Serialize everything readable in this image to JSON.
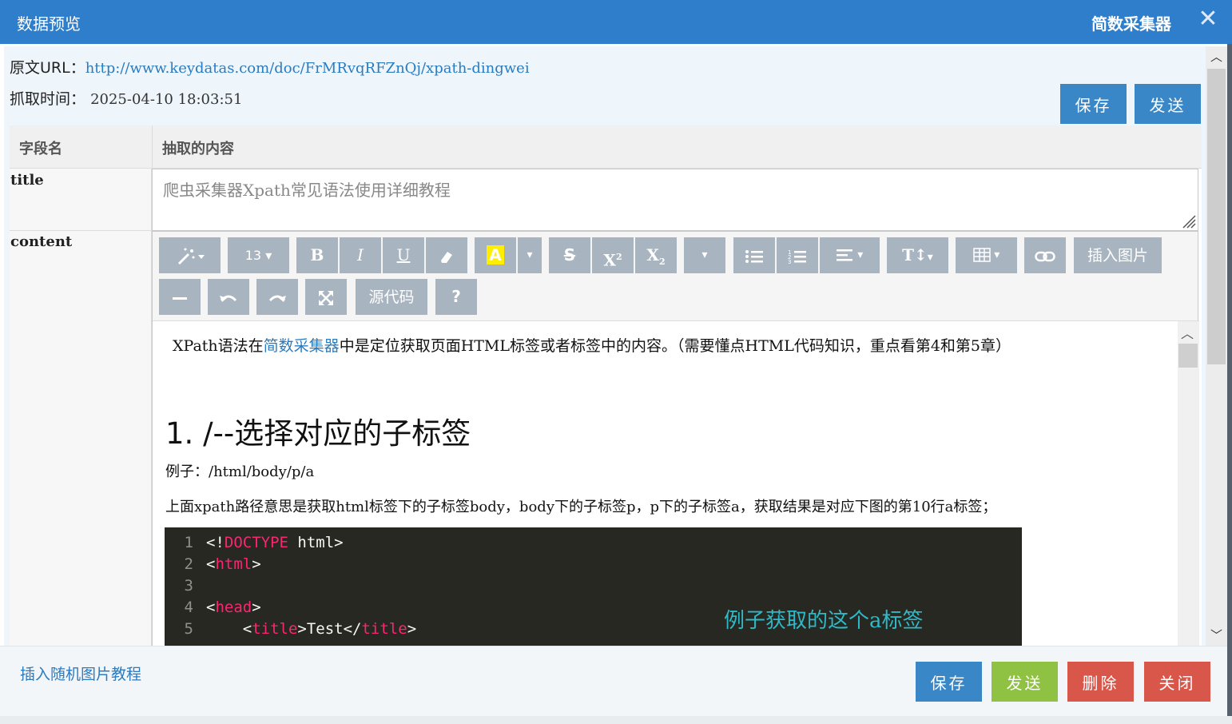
{
  "window": {
    "title": "数据预览",
    "brand": "简数采集器",
    "close_icon": "close-icon"
  },
  "meta": {
    "url_label": "原文URL：",
    "url_value": "http://www.keydatas.com/doc/FrMRvqRFZnQj/xpath-dingwei",
    "time_label": "抓取时间：",
    "time_value": "2025-04-10 18:03:51"
  },
  "top_buttons": {
    "save": "保存",
    "send": "发送"
  },
  "table": {
    "header_field": "字段名",
    "header_content": "抽取的内容",
    "rows": [
      {
        "field": "title",
        "value": "爬虫采集器Xpath常见语法使用详细教程"
      },
      {
        "field": "content"
      }
    ]
  },
  "toolbar": {
    "magic": "magic-wand-icon",
    "font_size": "13",
    "bold": "B",
    "italic": "I",
    "underline": "U",
    "eraser": "eraser-icon",
    "highlight": "A",
    "strike": "S",
    "superscript": "X",
    "subscript": "X",
    "insert_image": "插入图片",
    "source_code": "源代码",
    "help": "?"
  },
  "content": {
    "para1_pre": "XPath语法在",
    "para1_link": "简数采集器",
    "para1_post": "中是定位获取页面HTML标签或者标签中的内容。（需要懂点HTML代码知识，重点看第4和第5章）",
    "heading": "1.  /--选择对应的子标签",
    "para2": "例子：/html/body/p/a",
    "para3": "上面xpath路径意思是获取html标签下的子标签body，body下的子标签p，p下的子标签a，获取结果是对应下图的第10行a标签；",
    "code_lines": [
      {
        "n": "1",
        "pre": "<!",
        "kw": "DOCTYPE",
        "post": " html>"
      },
      {
        "n": "2",
        "pre": "<",
        "kw": "html",
        "post": ">"
      },
      {
        "n": "3",
        "pre": "",
        "kw": "",
        "post": ""
      },
      {
        "n": "4",
        "pre": "<",
        "kw": "head",
        "post": ">"
      },
      {
        "n": "5",
        "pre": "    <",
        "kw": "title",
        "post": ">Test</",
        "kw2": "title",
        "post2": ">"
      }
    ],
    "annotation": "例子获取的这个a标签"
  },
  "footer": {
    "link": "插入随机图片教程",
    "save": "保存",
    "send": "发送",
    "delete": "删除",
    "close": "关闭"
  },
  "colors": {
    "titlebar": "#2f7ecb",
    "button_blue": "#3a87c8",
    "button_green": "#8fc242",
    "button_red": "#d8574a",
    "toolbar_button": "#a8b4bf",
    "link": "#2b7bbf"
  }
}
